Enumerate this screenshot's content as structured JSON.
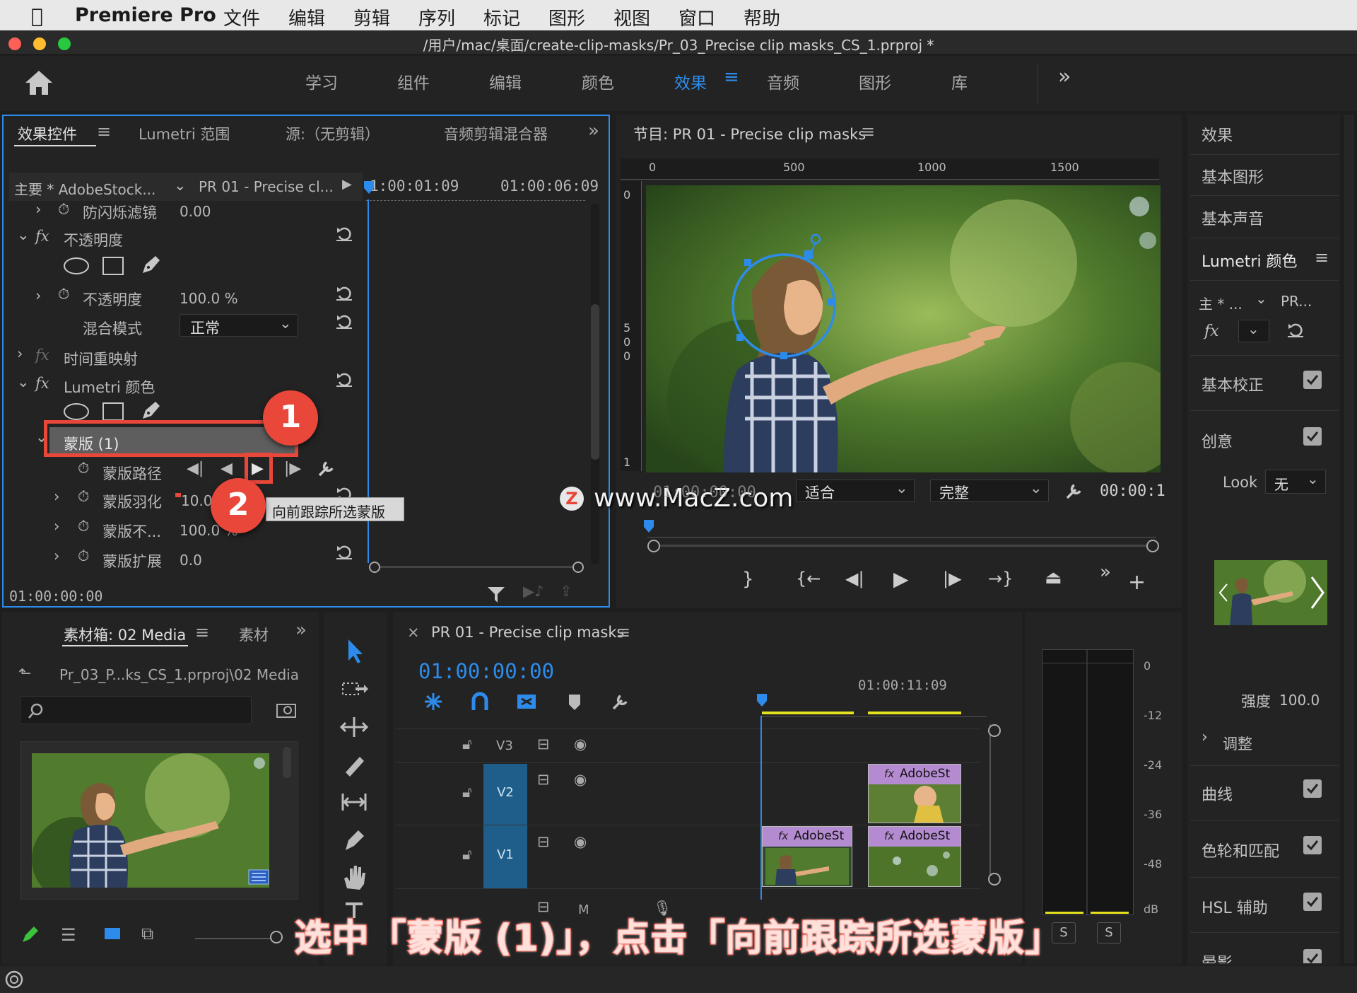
{
  "menubar": {
    "apple": "",
    "app": "Premiere Pro",
    "items": [
      "文件",
      "编辑",
      "剪辑",
      "序列",
      "标记",
      "图形",
      "视图",
      "窗口",
      "帮助"
    ]
  },
  "titlebar": {
    "title": "/用户/mac/桌面/create-clip-masks/Pr_03_Precise clip masks_CS_1.prproj *"
  },
  "workspaces": {
    "tabs": [
      "学习",
      "组件",
      "编辑",
      "颜色",
      "效果",
      "音频",
      "图形",
      "库"
    ],
    "active": "效果",
    "more": "»"
  },
  "effect_controls": {
    "tabs": [
      "效果控件",
      "Lumetri 范围",
      "源:（无剪辑）",
      "音频剪辑混合器"
    ],
    "master": "主要 * AdobeStock...",
    "sequence": "PR 01 - Precise cl...",
    "tc_left": "1:00:01:09",
    "tc_right": "01:00:06:09",
    "rows": {
      "anti_flicker": {
        "label": "防闪烁滤镜",
        "value": "0.00"
      },
      "opacity_group": "不透明度",
      "opacity": {
        "label": "不透明度",
        "value": "100.0 %"
      },
      "blend": {
        "label": "混合模式",
        "value": "正常"
      },
      "time_remap": "时间重映射",
      "lumetri": "Lumetri 颜色",
      "mask": "蒙版 (1)",
      "mask_path": "蒙版路径",
      "mask_feather": {
        "label": "蒙版羽化",
        "value": "10.0"
      },
      "mask_opacity": {
        "label": "蒙版不...",
        "value": "100.0 %"
      },
      "mask_expand": {
        "label": "蒙版扩展",
        "value": "0.0"
      }
    },
    "tooltip": "向前跟踪所选蒙版",
    "timecode": "01:00:00:00",
    "fx": "fx"
  },
  "program": {
    "title": "节目: PR 01 - Precise clip masks",
    "ruler": [
      "0",
      "500",
      "1000",
      "1500"
    ],
    "vruler": [
      "0",
      "5",
      "0",
      "0",
      "1"
    ],
    "timecode": "01:00:00:00",
    "fit": "适合",
    "quality": "完整",
    "tc_right": "00:00:1"
  },
  "watermark": "www.MacZ.com",
  "bin": {
    "tabs": [
      "素材箱: 02 Media",
      "素材"
    ],
    "path": "Pr_03_P...ks_CS_1.prproj\\02 Media"
  },
  "timeline": {
    "title": "PR 01 - Precise clip masks",
    "timecode": "01:00:00:00",
    "ruler_tc": "01:00:11:09",
    "tracks": [
      "V3",
      "V2",
      "V1"
    ],
    "mute": "M",
    "clips": [
      "AdobeSt",
      "AdobeSt",
      "AdobeSt"
    ]
  },
  "meter": {
    "labels": [
      "0",
      "-12",
      "-24",
      "-36",
      "-48",
      "dB"
    ],
    "solo": [
      "S",
      "S"
    ]
  },
  "lumetri_panel": {
    "items": [
      "效果",
      "基本图形",
      "基本声音",
      "Lumetri 颜色"
    ],
    "master": "主 * ...",
    "seq": "PR...",
    "sections": [
      "基本校正",
      "创意",
      "曲线",
      "色轮和匹配",
      "HSL 辅助",
      "晕影"
    ],
    "look_label": "Look",
    "look_value": "无",
    "intensity_label": "强度",
    "intensity_value": "100.0",
    "adjust": "调整"
  },
  "callouts": [
    "1",
    "2"
  ],
  "caption": "选中「蒙版 (1)」，点击「向前跟踪所选蒙版」",
  "colors": {
    "accent": "#2d8ceb",
    "highlight": "#e8473a",
    "clip": "#b48ad1",
    "track": "#1f5e8a",
    "marker": "#e4e21e"
  }
}
